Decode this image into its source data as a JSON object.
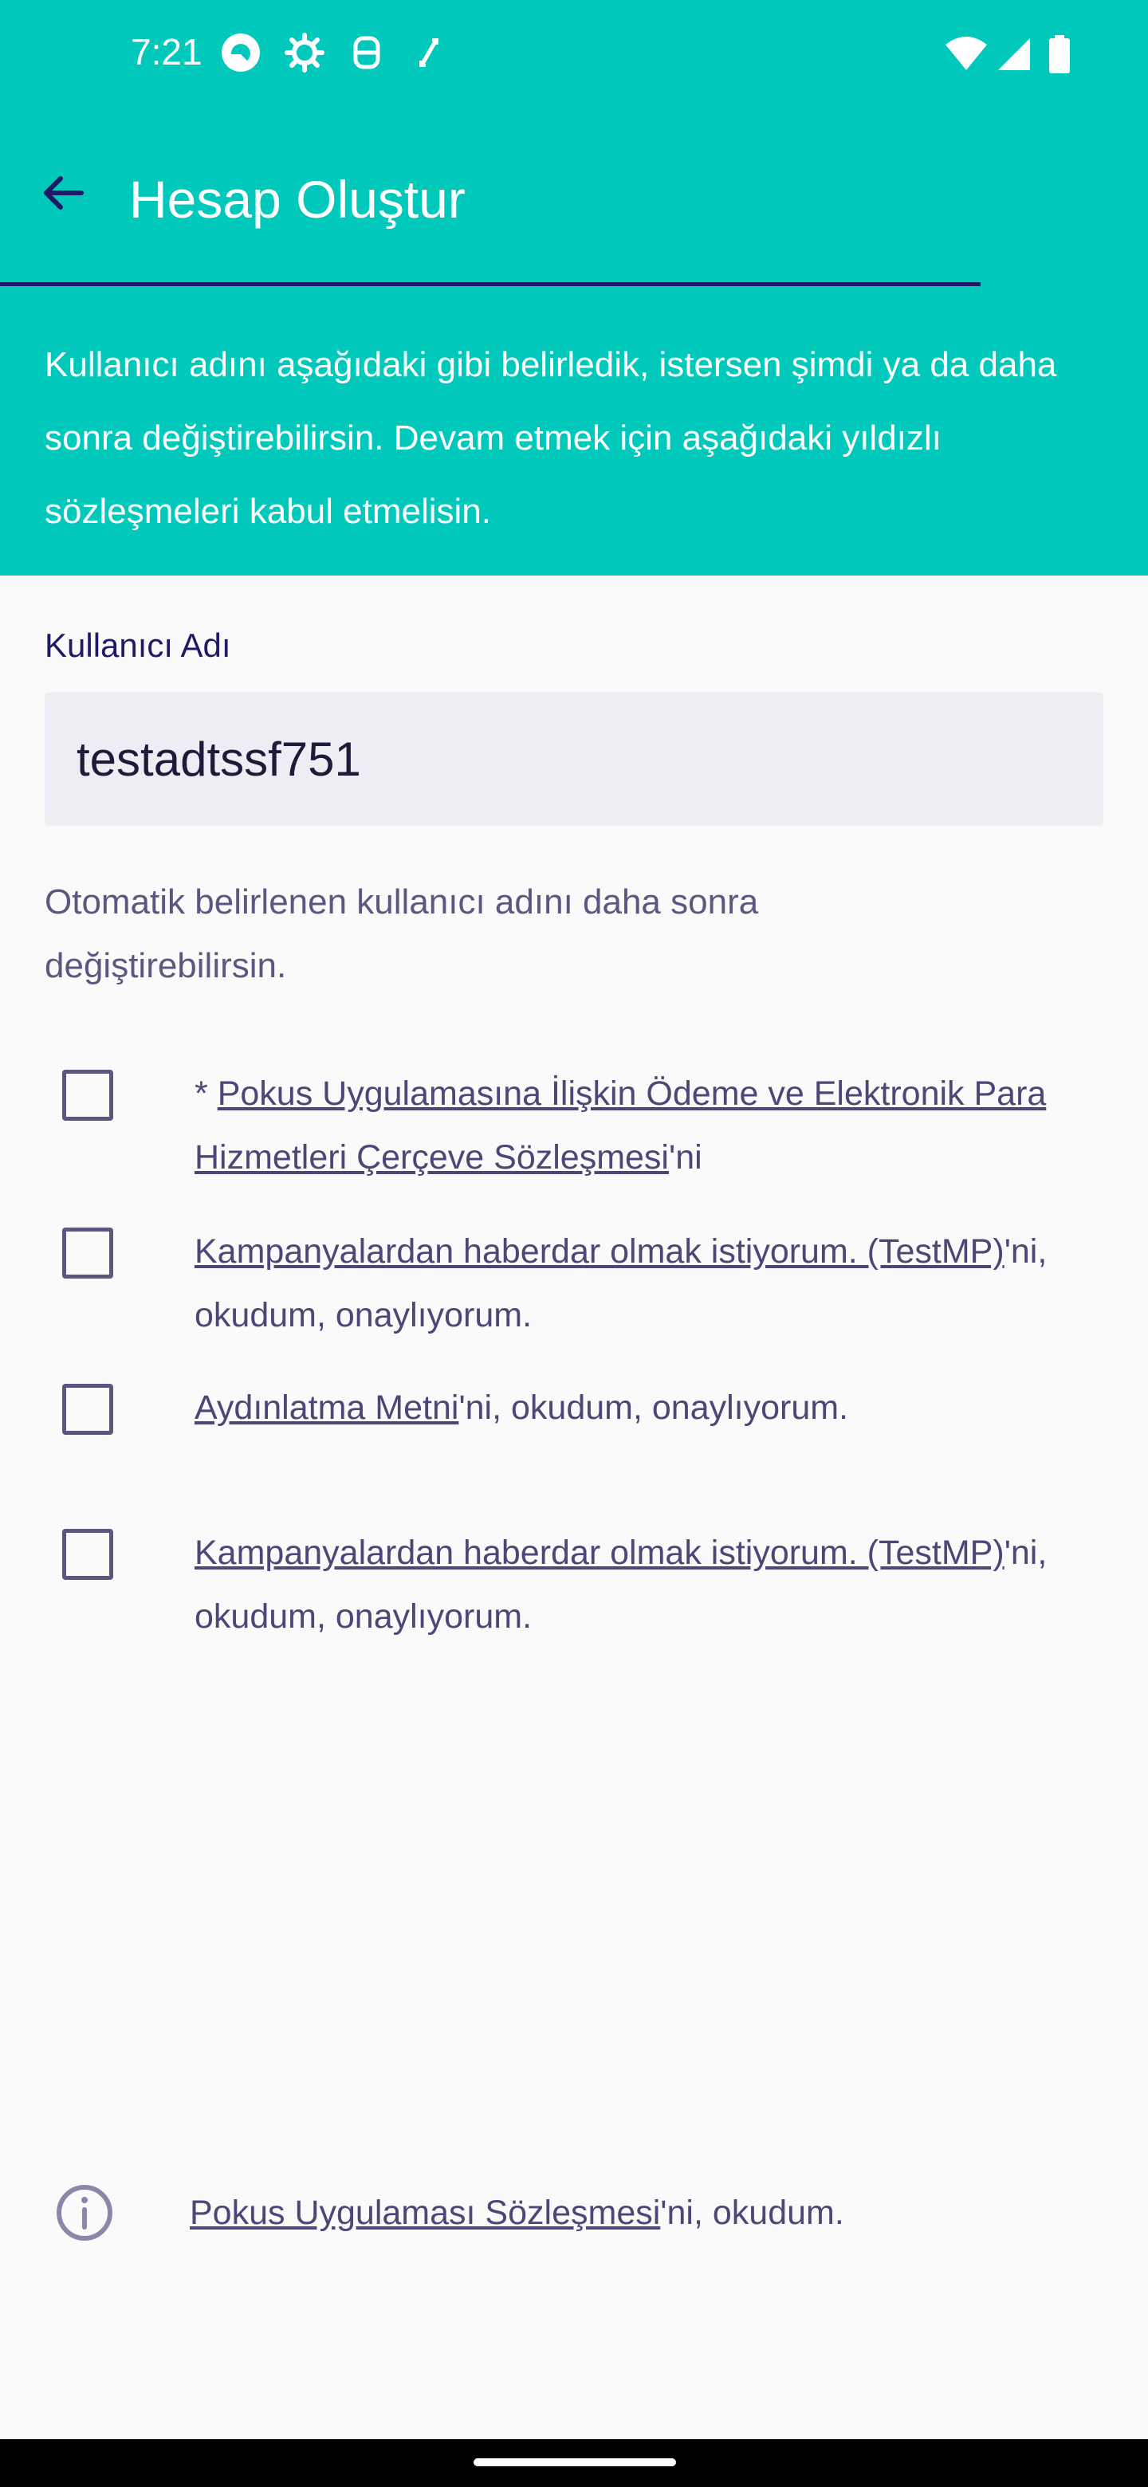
{
  "status_bar": {
    "time": "7:21",
    "icons_left": [
      "app-notification-icon",
      "settings-icon",
      "android-debug-icon",
      "screen-rotate-icon"
    ],
    "icons_right": [
      "wifi-icon",
      "cellular-signal-icon",
      "battery-icon"
    ]
  },
  "app_bar": {
    "title": "Hesap Oluştur",
    "back_icon": "arrow-back-icon"
  },
  "info": {
    "text": "Kullanıcı adını aşağıdaki gibi belirledik, istersen şimdi ya da daha sonra değiştirebilirsin. Devam etmek için aşağıdaki yıldızlı sözleşmeleri kabul etmelisin."
  },
  "username": {
    "label": "Kullanıcı Adı",
    "value": "testadtssf751"
  },
  "helper_text": "Otomatik belirlenen kullanıcı adını daha sonra değiştirebilirsin.",
  "consents": [
    {
      "prefix": " * ",
      "link": "Pokus Uygulamasına İlişkin Ödeme ve Elektronik Para Hizmetleri Çerçeve Sözleşmesi",
      "suffix": "'ni",
      "checked": false
    },
    {
      "prefix": "",
      "link": "Kampanyalardan haberdar olmak istiyorum. (TestMP)",
      "suffix": "'ni, okudum, onaylıyorum.",
      "checked": false
    },
    {
      "prefix": "",
      "link": "Aydınlatma Metni",
      "suffix": "'ni, okudum, onaylıyorum.",
      "checked": false
    },
    {
      "prefix": "",
      "link": "Kampanyalardan haberdar olmak istiyorum. (TestMP)",
      "suffix": "'ni, okudum, onaylıyorum.",
      "checked": false
    }
  ],
  "footer_info": {
    "icon": "info-icon",
    "link": "Pokus Uygulaması Sözleşmesi",
    "suffix": "'ni, okudum."
  },
  "colors": {
    "accent": "#00c8bb",
    "primary_dark": "#1f1a66",
    "text_muted": "#4b4776"
  }
}
